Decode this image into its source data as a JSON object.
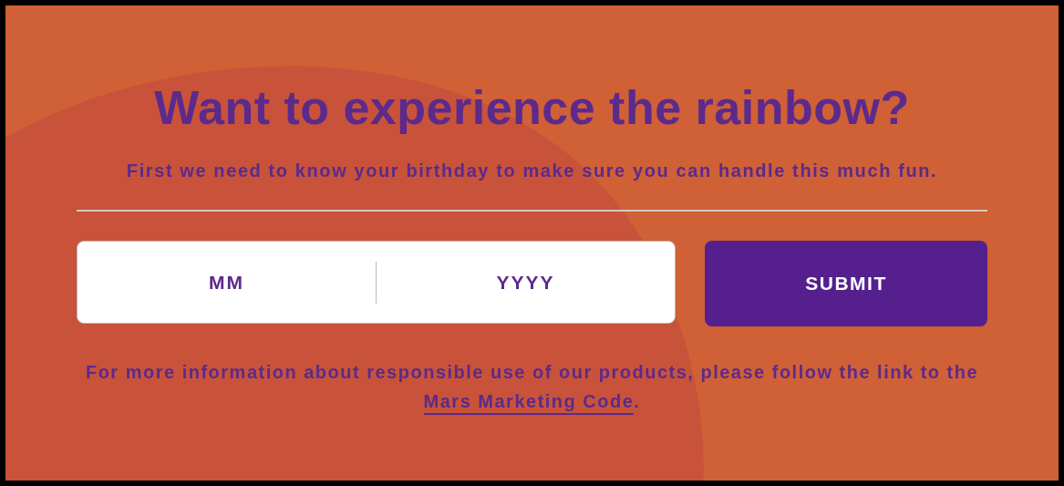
{
  "heading": "Want to experience the rainbow?",
  "subheading": "First we need to know your birthday to make sure you can handle this much fun.",
  "birthday_fields": [
    {
      "placeholder": "MM"
    },
    {
      "placeholder": "YYYY"
    }
  ],
  "submit_button": "SUBMIT",
  "footnote": {
    "text_before": "For more information about responsible use of our products, please follow the link to the",
    "link": "Mars Marketing Code",
    "text_after": "."
  }
}
